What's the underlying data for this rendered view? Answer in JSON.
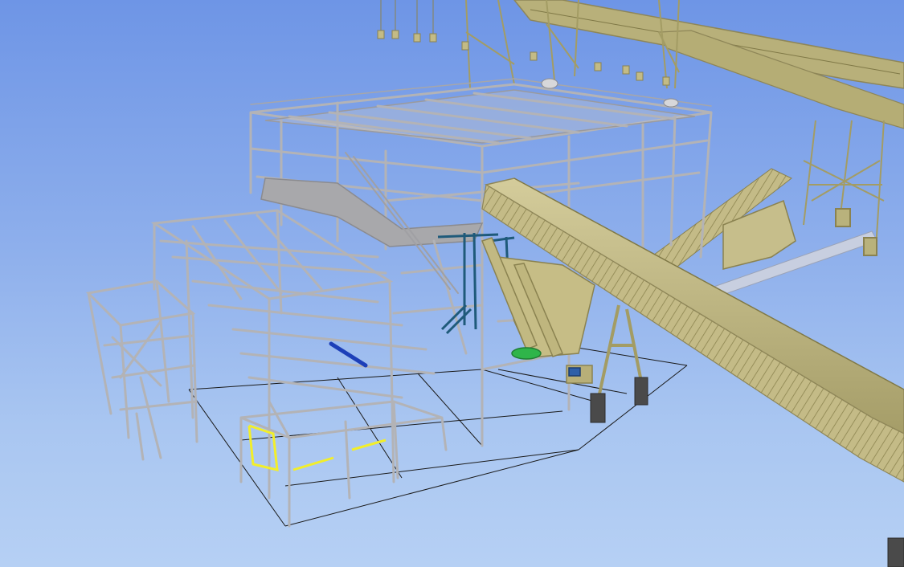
{
  "viewport": {
    "background_top": "#6e95e6",
    "background_bottom": "#b6d0f4"
  },
  "colors": {
    "steel": "#b7b7b9",
    "steel_shadow": "#7d7d82",
    "conveyor": "#c5bc8a",
    "conveyor_shadow": "#8e8658",
    "gantry": "#b9b27c",
    "grid_line": "#1a1a1a",
    "blue_member": "#1d3fb8",
    "teal_structure": "#1f5a7a",
    "yellow_rail": "#f2ee2a",
    "green_pad": "#2fb54a",
    "pier_block": "#4a4a4a",
    "platform": "#a5a5a8"
  }
}
